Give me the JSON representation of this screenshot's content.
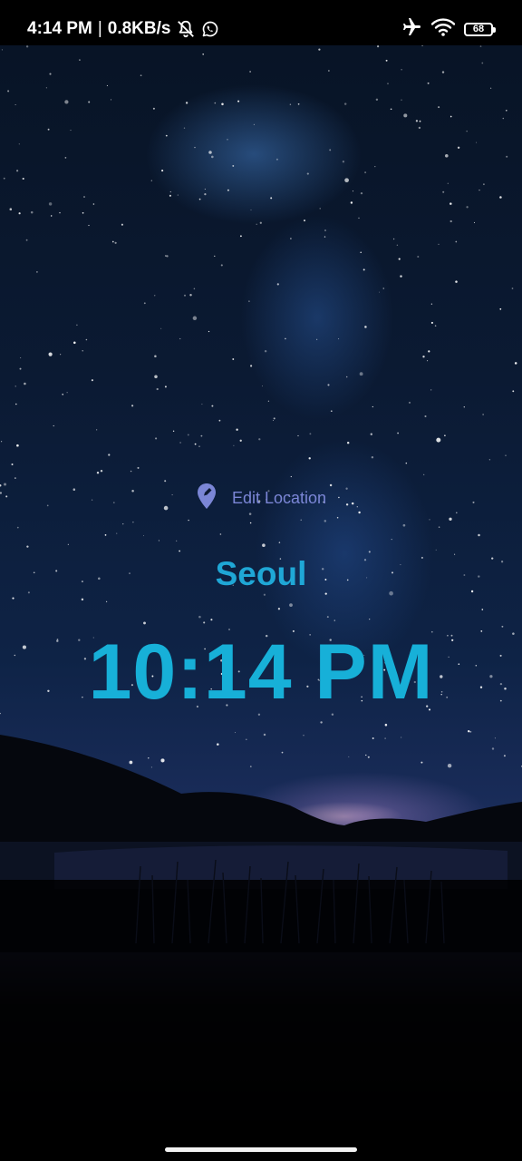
{
  "status_bar": {
    "time": "4:14 PM",
    "separator": "|",
    "network_speed": "0.8KB/s",
    "left_icons": [
      "notifications-muted-icon",
      "whatsapp-icon"
    ],
    "right_icons": [
      "airplane-mode-icon",
      "wifi-icon",
      "battery-icon"
    ],
    "battery_level": "68"
  },
  "location": {
    "edit_label": "Edit Location",
    "icon": "location-pin-icon",
    "city": "Seoul"
  },
  "clock": {
    "time": "10:14 PM"
  },
  "colors": {
    "accent_city": "#1fa7d6",
    "accent_clock": "#17b0d8",
    "edit_location": "#7b86d6"
  }
}
